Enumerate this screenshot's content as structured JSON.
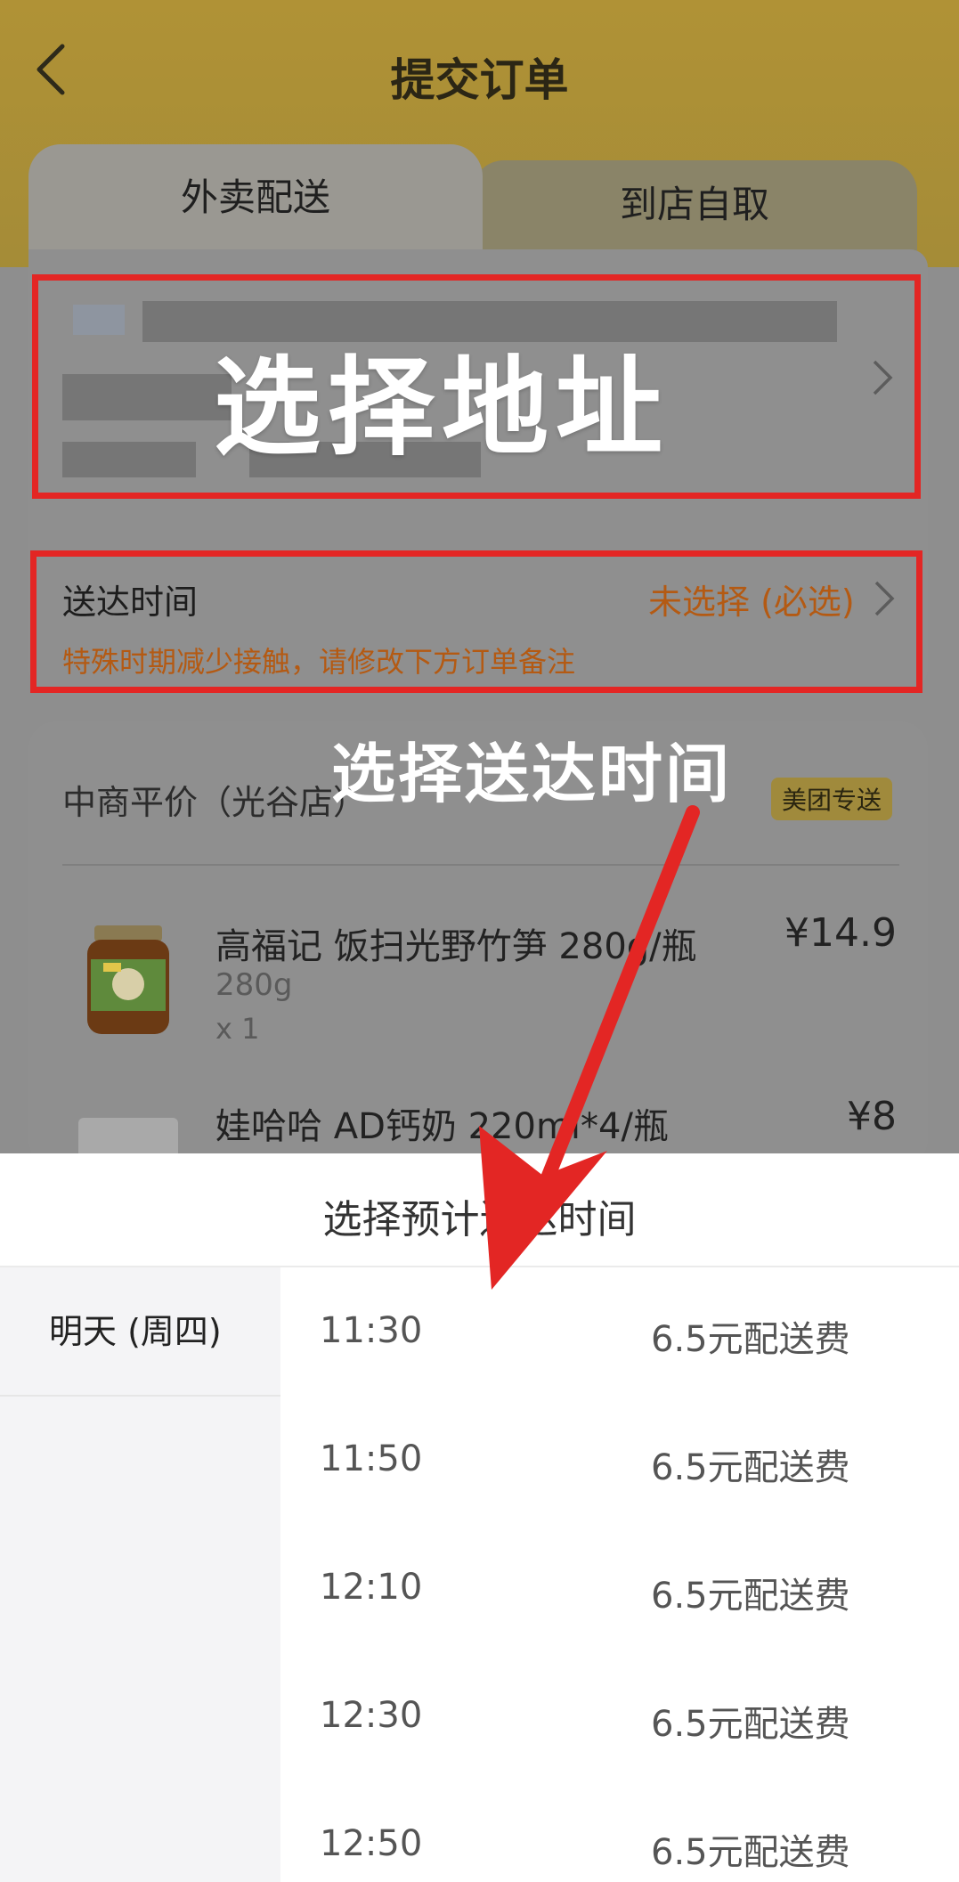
{
  "nav": {
    "title": "提交订单"
  },
  "tabs": [
    {
      "label": "外卖配送"
    },
    {
      "label": "到店自取"
    }
  ],
  "overlay": {
    "address_label": "选择地址",
    "time_label": "选择送达时间"
  },
  "delivery": {
    "label": "送达时间",
    "value": "未选择 (必选)",
    "note": "特殊时期减少接触，请修改下方订单备注"
  },
  "shop": {
    "name": "中商平价（光谷店）",
    "badge": "美团专送"
  },
  "products": [
    {
      "name": "高福记 饭扫光野竹笋 280g/瓶",
      "spec": "280g",
      "qty": "x 1",
      "price": "¥14.9"
    },
    {
      "name": "娃哈哈 AD钙奶 220ml*4/瓶",
      "price": "¥8"
    }
  ],
  "sheet": {
    "title": "选择预计送达时间",
    "day": "明天 (周四)",
    "slots": [
      {
        "time": "11:30",
        "fee": "6.5元配送费"
      },
      {
        "time": "11:50",
        "fee": "6.5元配送费"
      },
      {
        "time": "12:10",
        "fee": "6.5元配送费"
      },
      {
        "time": "12:30",
        "fee": "6.5元配送费"
      },
      {
        "time": "12:50",
        "fee": "6.5元配送费"
      }
    ]
  },
  "colors": {
    "annotation_red": "#e32624",
    "warning_orange": "#b45a13",
    "brand_yellow": "#b09236"
  }
}
